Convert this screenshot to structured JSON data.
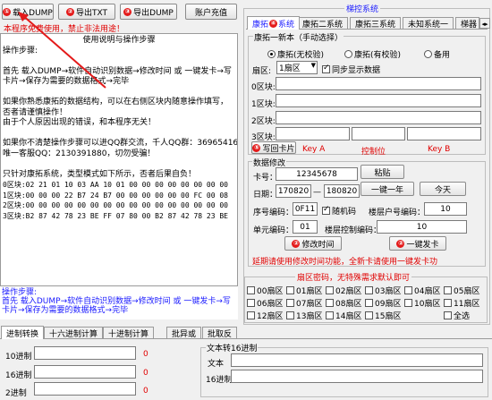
{
  "toolbar": {
    "load_dump": {
      "num": "①",
      "label": "载入DUMP"
    },
    "export_txt": {
      "num": "②",
      "label": "导出TXT"
    },
    "export_dump": {
      "num": "③",
      "label": "导出DUMP"
    },
    "recharge": "账户充值"
  },
  "warning_text": "本程序免费使用，禁止非法用途！",
  "help_title": "使用说明与操作步骤",
  "help_lines": [
    "操作步骤:",
    "",
    "首先 载入DUMP→软件自动识别数据→修改时间 或 一键发卡→写",
    "卡片→保存为需要的数据格式→完毕",
    "",
    "如果你熟悉康拓的数据结构，可以在右侧区块内随意操作填写，",
    "否者请谨慎操作！",
    "由于个人原因出现的错误，和本程序无关！",
    "",
    "如果你不清楚操作步骤可以进QQ群交流，千人QQ群：369654166",
    "唯一客服QQ：2130391880，切勿受骗！",
    "",
    "只针对康拓系统，类型模式如下所示，否者后果自负！"
  ],
  "hex_lines": [
    "0区块:02 21 01 10 03 AA 10 01 00 00 00 00 00 00 00 00",
    "1区块:00 00 00 22 B7 24 B7 00 00 00 00 00 00 FC 00 08",
    "2区块:00 00 00 00 00 00 00 00 00 00 00 00 00 00 00 00",
    "3区块:B2 87 42 78 23 BE FF 07 80 00 B2 87 42 78 23 BE"
  ],
  "status_text": "操作步骤:\n首先 载入DUMP→软件自动识别数据→修改时间 或 一键发卡→写\n卡片→保存为需要的数据格式→完毕",
  "bottom_tabs": [
    "进制转换",
    "十六进制计算",
    "十进制计算",
    "批异或",
    "批取反"
  ],
  "base_convert": {
    "rows": [
      {
        "label": "10进制",
        "value": "",
        "result": "0"
      },
      {
        "label": "16进制",
        "value": "",
        "result": "0"
      },
      {
        "label": "2进制",
        "value": "",
        "result": "0"
      }
    ]
  },
  "text_to_hex": {
    "title": "文本转16进制",
    "text_label": "文本",
    "hex_label": "16进制",
    "text_value": "",
    "hex_value": ""
  },
  "right_panel": {
    "title": "梯控系统",
    "tabs": [
      {
        "num": "④",
        "label": "康拓",
        "suffix": "系统"
      },
      {
        "label": "康拓二系统"
      },
      {
        "label": "康拓三系统"
      },
      {
        "label": "未知系统一"
      },
      {
        "label": "梯器"
      }
    ],
    "version_group": {
      "title": "康拓一新本（手动选择）",
      "radios": [
        {
          "label": "康拓(无校验)",
          "checked": true
        },
        {
          "label": "康拓(有校验)",
          "checked": false
        },
        {
          "label": "备用",
          "checked": false
        }
      ],
      "sector_label": "扇区:",
      "sector_value": "1扇区",
      "sync_label": "同步显示数据",
      "sync_checked": true,
      "blocks": [
        {
          "label": "0区块:",
          "value": ""
        },
        {
          "label": "1区块:",
          "value": ""
        },
        {
          "label": "2区块:",
          "value": ""
        },
        {
          "label": "3区块:",
          "value": ""
        }
      ],
      "write_button": {
        "num": "⑤",
        "label": "写回卡片"
      },
      "key_a": "Key A",
      "control_bits": "控制位",
      "key_b": "Key B"
    },
    "modify_group": {
      "title": "数据修改",
      "card_label": "卡号：",
      "card_value": "12345678",
      "paste_button": "粘贴",
      "date_label": "日期：",
      "date_from": "170820",
      "date_sep": "—",
      "date_to": "180820",
      "one_year_button": "一键一年",
      "today_button": "今天",
      "serial_label": "序号编码：",
      "serial_value": "0F11",
      "random_label": "随机码",
      "random_checked": true,
      "household_label": "楼层户号编码：",
      "household_value": "10",
      "unit_label": "单元编码：",
      "unit_value": "01",
      "floor_ctrl_label": "楼层控制编码：",
      "floor_ctrl_value": "10",
      "modify_time_button": {
        "num": "②",
        "label": "修改时间"
      },
      "one_click_card_button": {
        "num": "②",
        "label": "一键发卡"
      },
      "tip": "延期请使用修改时间功能，全新卡请使用一键发卡功"
    },
    "sector_pwd": {
      "title": "扇区密码，无特殊需求默认即可",
      "items": [
        "00扇区",
        "01扇区",
        "02扇区",
        "03扇区",
        "04扇区",
        "05扇区",
        "06扇区",
        "07扇区",
        "08扇区",
        "09扇区",
        "10扇区",
        "11扇区",
        "12扇区",
        "13扇区",
        "14扇区",
        "15扇区",
        "全选"
      ]
    }
  },
  "colors": {
    "accent_red": "#e00000",
    "link_blue": "#1a1aff",
    "window_bg": "#f0f0f0"
  }
}
